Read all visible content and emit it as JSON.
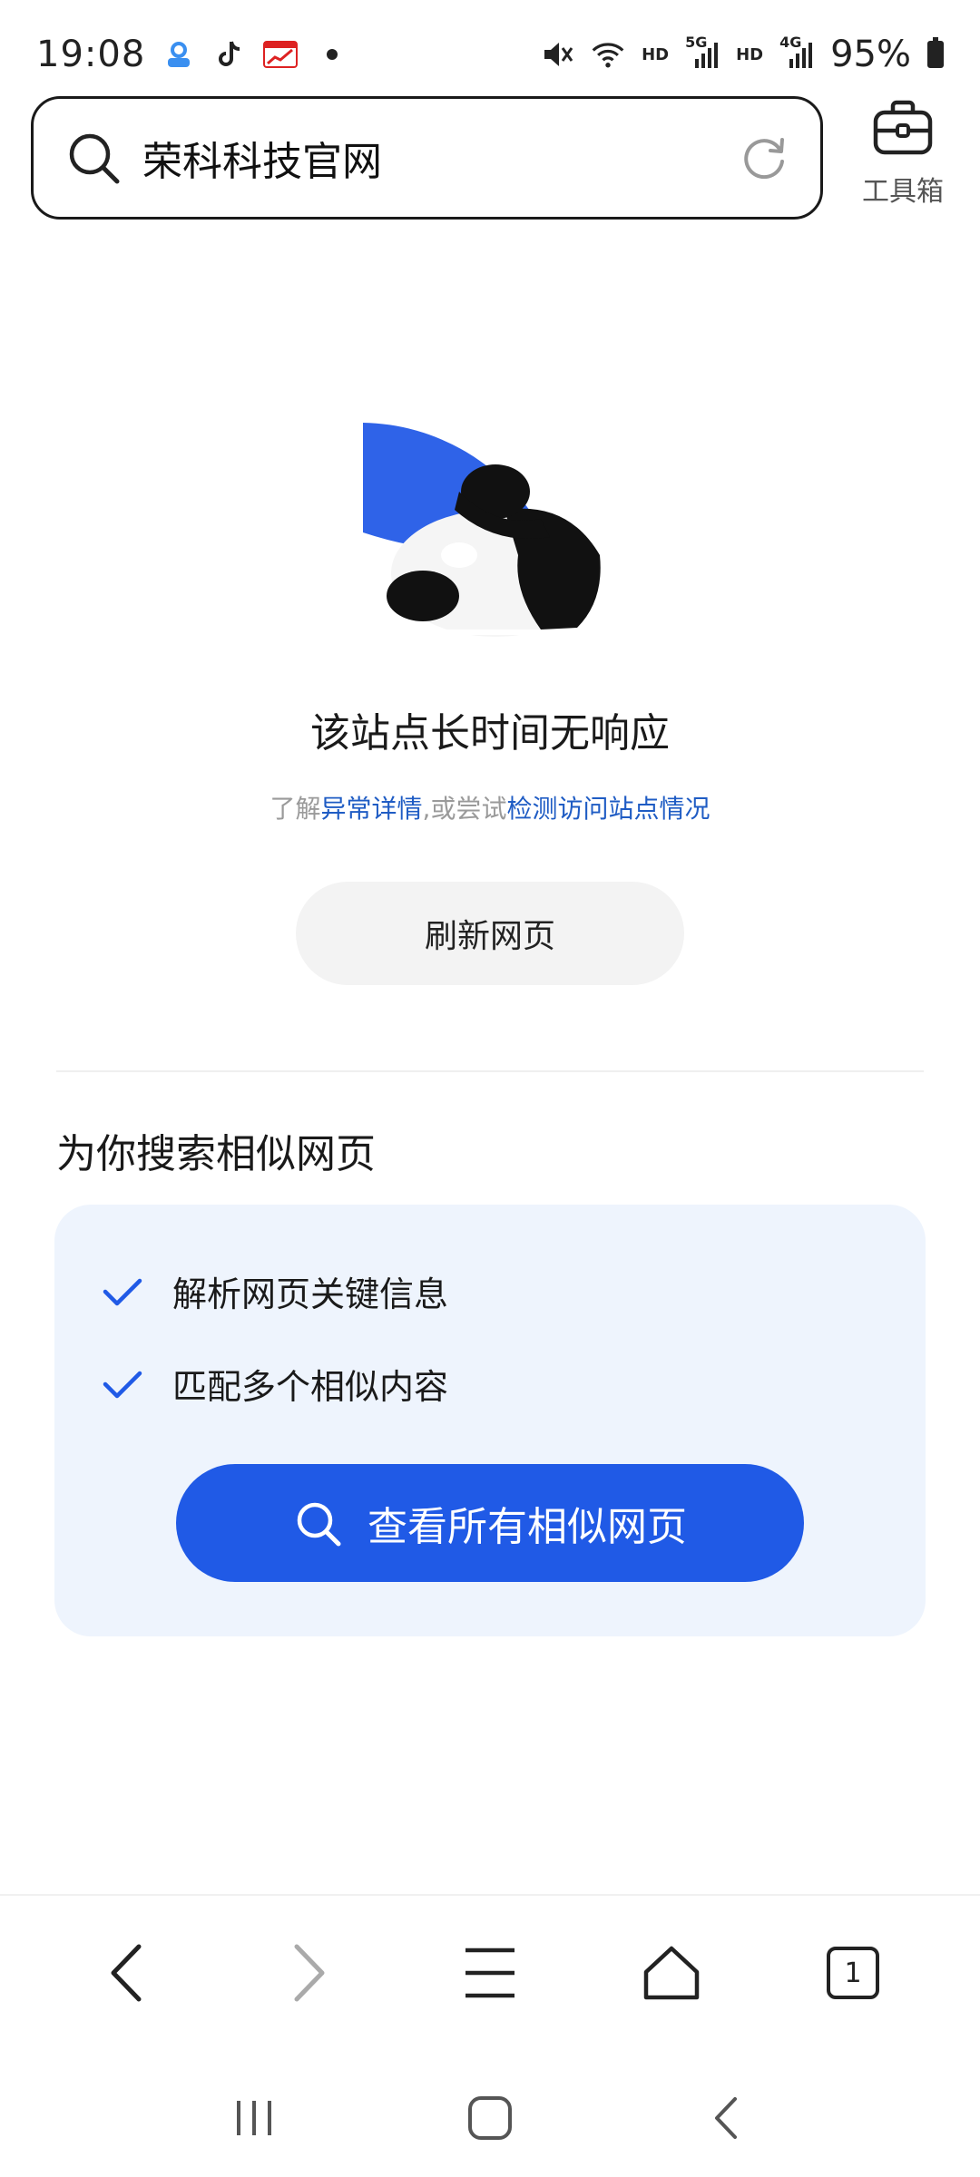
{
  "status_bar": {
    "time": "19:08",
    "hd1": "HD",
    "net1": "5G",
    "hd2": "HD",
    "net2": "4G",
    "battery": "95%"
  },
  "header": {
    "search_text": "荣科科技官网",
    "toolbox_label": "工具箱"
  },
  "error": {
    "title": "该站点长时间无响应",
    "sub_prefix": "了解",
    "sub_link1": "异常详情",
    "sub_middle": ",或尝试",
    "sub_link2": "检测访问站点情况",
    "refresh_label": "刷新网页"
  },
  "similar": {
    "section_title": "为你搜索相似网页",
    "item1": "解析网页关键信息",
    "item2": "匹配多个相似内容",
    "button_label": "查看所有相似网页"
  },
  "browser_nav": {
    "tab_count": "1"
  },
  "colors": {
    "accent": "#205ae6",
    "link": "#1f5cc4",
    "card_bg": "#eef4fd"
  },
  "icons": [
    "search-icon",
    "refresh-icon",
    "toolbox-icon",
    "check-icon",
    "back-icon",
    "forward-icon",
    "menu-icon",
    "home-icon",
    "tabs-icon",
    "recents-icon",
    "system-home-icon",
    "system-back-icon"
  ]
}
